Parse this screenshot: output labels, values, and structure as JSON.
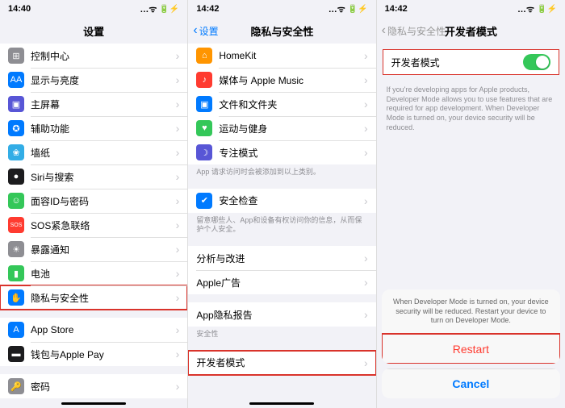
{
  "s1": {
    "time": "14:40",
    "title": "设置",
    "rows": [
      {
        "icon": "bg-gray",
        "glyph": "⊞",
        "label": "控制中心"
      },
      {
        "icon": "bg-blue",
        "glyph": "AA",
        "label": "显示与亮度"
      },
      {
        "icon": "bg-indigo",
        "glyph": "▣",
        "label": "主屏幕"
      },
      {
        "icon": "bg-blue",
        "glyph": "✪",
        "label": "辅助功能"
      },
      {
        "icon": "bg-cyan",
        "glyph": "❀",
        "label": "墙纸"
      },
      {
        "icon": "bg-black",
        "glyph": "●",
        "label": "Siri与搜索"
      },
      {
        "icon": "bg-green",
        "glyph": "☺",
        "label": "面容ID与密码"
      },
      {
        "icon": "bg-red",
        "glyph": "SOS",
        "label": "SOS紧急联络"
      },
      {
        "icon": "bg-gray",
        "glyph": "☀",
        "label": "暴露通知"
      },
      {
        "icon": "bg-green",
        "glyph": "▮",
        "label": "电池"
      },
      {
        "icon": "bg-blue",
        "glyph": "✋",
        "label": "隐私与安全性",
        "hl": true
      }
    ],
    "rows2": [
      {
        "icon": "bg-blue",
        "glyph": "A",
        "label": "App Store"
      },
      {
        "icon": "bg-black",
        "glyph": "▬",
        "label": "钱包与Apple Pay"
      }
    ],
    "rows3": [
      {
        "icon": "bg-gray",
        "glyph": "🔑",
        "label": "密码"
      }
    ]
  },
  "s2": {
    "time": "14:42",
    "back": "设置",
    "title": "隐私与安全性",
    "rowsA": [
      {
        "icon": "bg-orange",
        "glyph": "⌂",
        "label": "HomeKit"
      },
      {
        "icon": "bg-red",
        "glyph": "♪",
        "label": "媒体与 Apple Music"
      },
      {
        "icon": "bg-blue",
        "glyph": "▣",
        "label": "文件和文件夹"
      },
      {
        "icon": "bg-green",
        "glyph": "♥",
        "label": "运动与健身"
      },
      {
        "icon": "bg-indigo",
        "glyph": "☽",
        "label": "专注模式"
      }
    ],
    "footA": "App 请求访问时会被添加到以上类别。",
    "rowsB": [
      {
        "icon": "bg-blue",
        "glyph": "✔",
        "label": "安全检查"
      }
    ],
    "footB": "留意哪些人、App和设备有权访问你的信息，从而保护个人安全。",
    "rowsC": [
      {
        "label": "分析与改进"
      },
      {
        "label": "Apple广告"
      }
    ],
    "rowsD": [
      {
        "label": "App隐私报告"
      }
    ],
    "headE": "安全性",
    "rowsE": [
      {
        "label": "开发者模式",
        "hl": true
      }
    ]
  },
  "s3": {
    "time": "14:42",
    "back": "隐私与安全性",
    "title": "开发者模式",
    "toggle_label": "开发者模式",
    "info": "If you're developing apps for Apple products, Developer Mode allows you to use features that are required for app development. When Developer Mode is turned on, your device security will be reduced.",
    "sheet_msg": "When Developer Mode is turned on, your device security will be reduced. Restart your device to turn on Developer Mode.",
    "restart": "Restart",
    "cancel": "Cancel"
  }
}
